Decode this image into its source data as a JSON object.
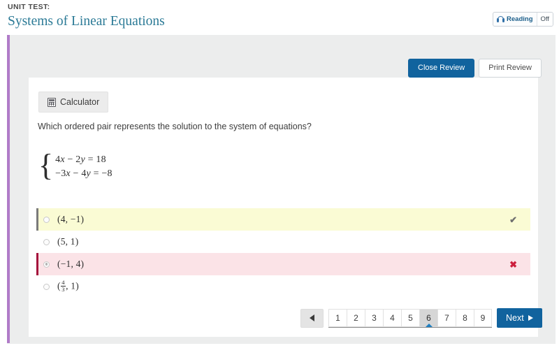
{
  "header": {
    "eyebrow": "UNIT TEST:",
    "title": "Systems of Linear Equations",
    "reading_toggle": {
      "icon": "headphones-icon",
      "label": "Reading",
      "state": "Off"
    }
  },
  "review_actions": {
    "close_label": "Close Review",
    "print_label": "Print Review"
  },
  "question": {
    "calculator_label": "Calculator",
    "calculator_icon": "calculator-icon",
    "prompt": "Which ordered pair represents the solution to the system of equations?",
    "equations": {
      "brace": "{",
      "line1_a": "4",
      "line1_x": "x",
      "line1_b": " − 2",
      "line1_y": "y",
      "line1_c": " = 18",
      "line2_a": "−3",
      "line2_x": "x",
      "line2_b": " − 4",
      "line2_y": "y",
      "line2_c": " = −8"
    },
    "options": [
      {
        "text": "(4,  −1)",
        "selected": false,
        "state": "correct",
        "mark": "✔",
        "mark_name": "check-mark-icon"
      },
      {
        "text": "(5, 1)",
        "selected": false,
        "state": "neutral",
        "mark": "",
        "mark_name": ""
      },
      {
        "text": "(−1, 4)",
        "selected": true,
        "state": "incorrect",
        "mark": "✖",
        "mark_name": "cross-mark-icon"
      },
      {
        "text": "",
        "fraction": {
          "numerator": "4",
          "denominator": "3"
        },
        "text_suffix": ", 1)",
        "text_prefix": "(",
        "selected": false,
        "state": "neutral",
        "mark": "",
        "mark_name": ""
      }
    ]
  },
  "pagination": {
    "prev_icon": "triangle-left-icon",
    "pages": [
      "1",
      "2",
      "3",
      "4",
      "5",
      "6",
      "7",
      "8",
      "9"
    ],
    "active_page": "6",
    "next_label": "Next",
    "next_icon": "triangle-right-icon"
  },
  "colors": {
    "title_teal": "#2b7a96",
    "primary_blue": "#11639e",
    "accent_purple": "#b07bc8",
    "correct_yellow": "#fafbd4",
    "incorrect_pink": "#fbe3e7",
    "incorrect_bar": "#a4123c",
    "correct_bar": "#7a7a7a",
    "cross_red": "#cc1f3d"
  }
}
